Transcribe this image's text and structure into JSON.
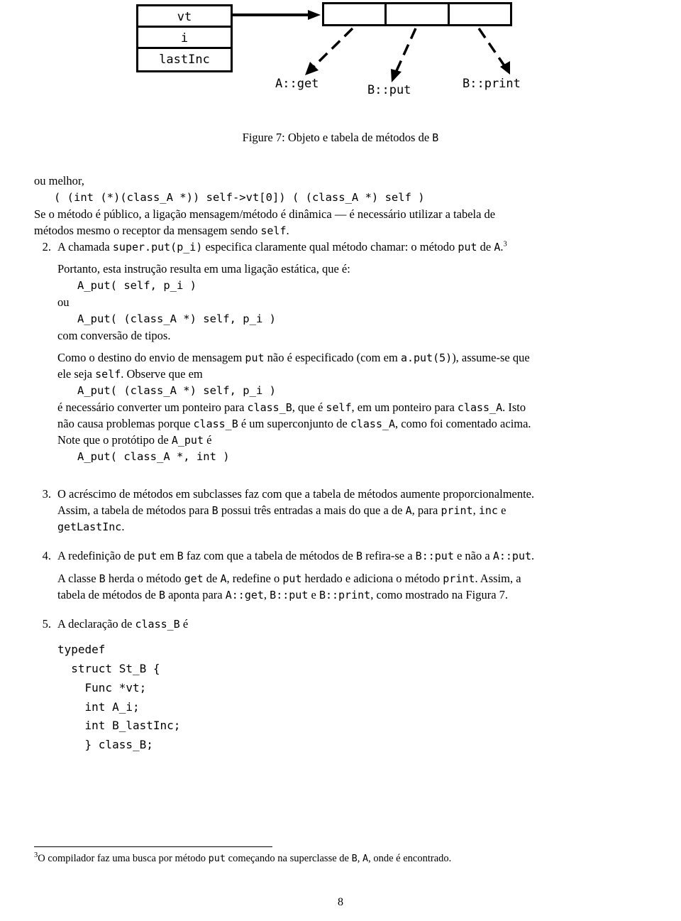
{
  "figure": {
    "object_box": {
      "name": "object-b",
      "fields": [
        "vt",
        "i",
        "lastInc"
      ]
    },
    "method_table": {
      "name": "method-table-b",
      "cells": 3,
      "entries": [
        "A::get",
        "B::put",
        "B::print"
      ]
    },
    "caption": "Figure 7: Objeto e tabela de métodos de B",
    "caption_prefix": "Figure 7:",
    "caption_text": "Objeto e tabela de métodos de",
    "caption_class": "B"
  },
  "body": {
    "intro_line": "ou melhor,",
    "intro_code": "( (int (*)(class_A *)) self->vt[0]) ( (class_A *) self )",
    "intro_para_a": "Se o método é público, a ligação mensagem/método é dinâmica — é necessário utilizar a tabela de",
    "intro_para_b_1": "métodos mesmo o receptor da mensagem sendo",
    "intro_para_b_code": "self",
    "intro_para_b_2": "."
  },
  "items": [
    {
      "num": "2.",
      "lines": {
        "l1_a": "A chamada",
        "l1_code1": "super.put(p_i)",
        "l1_b": "especifica claramente qual método chamar: o método",
        "l1_code2": "put",
        "l1_c": "de",
        "l1_code3": "A",
        "l1_d": ".",
        "l1_sup": "3",
        "l2": "Portanto, esta instrução resulta em uma ligação estática, que é:",
        "code1": "A_put( self, p_i )",
        "l3": "ou",
        "code2": "A_put( (class_A *) self, p_i )",
        "l4": "com conversão de tipos.",
        "l5_a": "Como o destino do envio de mensagem",
        "l5_code1": "put",
        "l5_b": "não é especificado (com em",
        "l5_code2": "a.put(5)",
        "l5_c": "), assume-se que",
        "l6_a": "ele seja",
        "l6_code1": "self",
        "l6_b": ". Observe que em",
        "code3": "A_put( (class_A *) self, p_i )",
        "l7_a": "é necessário converter um ponteiro para",
        "l7_code1": "class_B",
        "l7_b": ", que é",
        "l7_code2": "self",
        "l7_c": ", em um ponteiro para",
        "l7_code3": "class_A",
        "l7_d": ". Isto",
        "l8_a": "não causa problemas porque",
        "l8_code1": "class_B",
        "l8_b": "é um superconjunto de",
        "l8_code2": "class_A",
        "l8_c": ", como foi comentado acima.",
        "l9_a": "Note que o protótipo de",
        "l9_code1": "A_put",
        "l9_b": "é",
        "code4": "A_put( class_A *, int )"
      }
    },
    {
      "num": "3.",
      "lines": {
        "p1": "O acréscimo de métodos em subclasses faz com que a tabela de métodos aumente proporcionalmente.",
        "p2_a": "Assim, a tabela de métodos para",
        "p2_code1": "B",
        "p2_b": "possui três entradas a mais do que a de",
        "p2_code2": "A",
        "p2_c": ", para",
        "p2_code3": "print",
        "p2_d": ",",
        "p2_code4": "inc",
        "p2_e": "e",
        "p3_code": "getLastInc",
        "p3_end": "."
      }
    },
    {
      "num": "4.",
      "lines": {
        "p1_a": "A redefinição de",
        "p1_code1": "put",
        "p1_b": "em",
        "p1_code2": "B",
        "p1_c": "faz com que a tabela de métodos de",
        "p1_code3": "B",
        "p1_d": "refira-se a",
        "p1_code4": "B::put",
        "p1_e": "e não a",
        "p1_code5": "A::put",
        "p1_f": ".",
        "p2_a": "A classe",
        "p2_code1": "B",
        "p2_b": "herda o método",
        "p2_code2": "get",
        "p2_c": "de",
        "p2_code3": "A",
        "p2_d": ", redefine o",
        "p2_code4": "put",
        "p2_e": "herdado e adiciona o método",
        "p2_code5": "print",
        "p2_f": ". Assim, a",
        "p3_a": "tabela de métodos de",
        "p3_code1": "B",
        "p3_b": "aponta para",
        "p3_code2": "A::get",
        "p3_c": ",",
        "p3_code3": "B::put",
        "p3_d": "e",
        "p3_code4": "B::print",
        "p3_e": ", como mostrado na Figura 7."
      }
    },
    {
      "num": "5.",
      "lines": {
        "p1_a": "A declaração de",
        "p1_code1": "class_B",
        "p1_b": "é",
        "code_block": "typedef\n  struct St_B {\n    Func *vt;\n    int A_i;\n    int B_lastInc;\n    } class_B;"
      }
    }
  ],
  "footnote": {
    "marker": "3",
    "a": "O compilador faz uma busca por método",
    "code1": "put",
    "b": "começando na superclasse de",
    "code2": "B",
    "c": ",",
    "code3": "A",
    "d": ", onde é encontrado."
  },
  "page_number": "8",
  "colors": {
    "text": "#000000",
    "background": "#ffffff",
    "rule": "#000000"
  }
}
